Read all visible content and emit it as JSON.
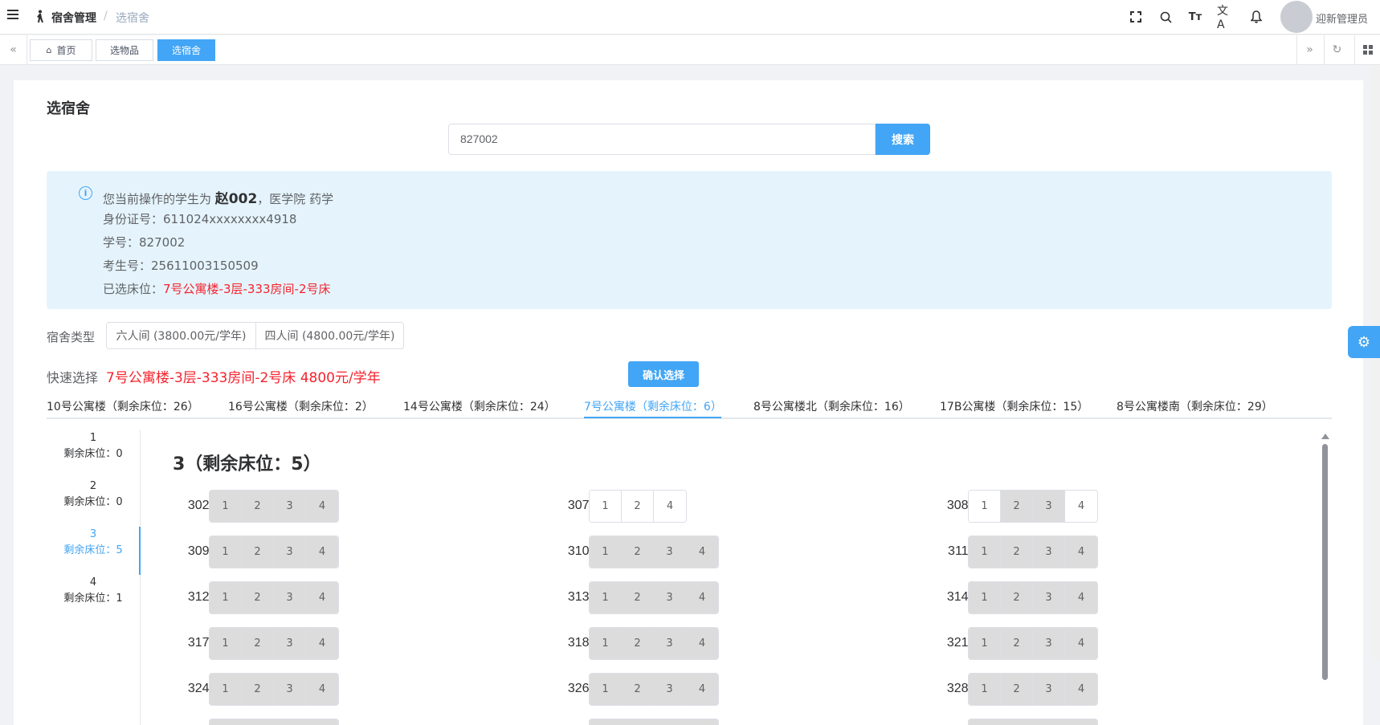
{
  "header": {
    "breadcrumb_root": "宿舍管理",
    "breadcrumb_sep": "/",
    "breadcrumb_current": "选宿舍",
    "user_name": "迎新管理员",
    "icons": [
      "fullscreen-icon",
      "search-icon",
      "font-size-icon",
      "translate-icon",
      "bell-icon"
    ]
  },
  "tags": [
    {
      "label": "首页",
      "icon": "home-icon"
    },
    {
      "label": "选物品"
    },
    {
      "label": "选宿舍",
      "active": true
    }
  ],
  "page": {
    "title": "选宿舍",
    "search_value": "827002",
    "search_button": "搜索"
  },
  "student": {
    "line1_prefix": "您当前操作的学生为",
    "name": "赵002",
    "line1_suffix": "，医学院 药学",
    "id_label": "身份证号：",
    "id_value": "611024xxxxxxxx4918",
    "sno_label": "学号：",
    "sno_value": "827002",
    "exam_label": "考生号：",
    "exam_value": "25611003150509",
    "selected_label": "已选床位：",
    "selected_value": "7号公寓楼-3层-333房间-2号床"
  },
  "room_types": {
    "label": "宿舍类型",
    "options": [
      "六人间 (3800.00元/学年)",
      "四人间 (4800.00元/学年)"
    ]
  },
  "quick": {
    "label": "快速选择",
    "value": "7号公寓楼-3层-333房间-2号床 4800元/学年",
    "confirm_button": "确认选择"
  },
  "buildings": [
    {
      "label": "10号公寓楼（剩余床位：26）"
    },
    {
      "label": "16号公寓楼（剩余床位：2）"
    },
    {
      "label": "14号公寓楼（剩余床位：24）"
    },
    {
      "label": "7号公寓楼（剩余床位：6）",
      "active": true
    },
    {
      "label": "8号公寓楼北（剩余床位：16）"
    },
    {
      "label": "17B公寓楼（剩余床位：15）"
    },
    {
      "label": "8号公寓楼南（剩余床位：29）"
    }
  ],
  "floors": [
    {
      "num": "1",
      "remain": "剩余床位：0"
    },
    {
      "num": "2",
      "remain": "剩余床位：0"
    },
    {
      "num": "3",
      "remain": "剩余床位：5",
      "active": true
    },
    {
      "num": "4",
      "remain": "剩余床位：1"
    }
  ],
  "floor_heading": "3（剩余床位：5）",
  "rooms": [
    {
      "label": "302:",
      "beds": [
        {
          "n": "1",
          "taken": true
        },
        {
          "n": "2",
          "taken": true
        },
        {
          "n": "3",
          "taken": true
        },
        {
          "n": "4",
          "taken": true
        }
      ]
    },
    {
      "label": "307:",
      "beds": [
        {
          "n": "1",
          "taken": false
        },
        {
          "n": "2",
          "taken": false
        },
        {
          "n": "4",
          "taken": false
        }
      ]
    },
    {
      "label": "308:",
      "beds": [
        {
          "n": "1",
          "taken": false
        },
        {
          "n": "2",
          "taken": true
        },
        {
          "n": "3",
          "taken": true
        },
        {
          "n": "4",
          "taken": false
        }
      ]
    },
    {
      "label": "309:",
      "beds": [
        {
          "n": "1",
          "taken": true
        },
        {
          "n": "2",
          "taken": true
        },
        {
          "n": "3",
          "taken": true
        },
        {
          "n": "4",
          "taken": true
        }
      ]
    },
    {
      "label": "310:",
      "beds": [
        {
          "n": "1",
          "taken": true
        },
        {
          "n": "2",
          "taken": true
        },
        {
          "n": "3",
          "taken": true
        },
        {
          "n": "4",
          "taken": true
        }
      ]
    },
    {
      "label": "311:",
      "beds": [
        {
          "n": "1",
          "taken": true
        },
        {
          "n": "2",
          "taken": true
        },
        {
          "n": "3",
          "taken": true
        },
        {
          "n": "4",
          "taken": true
        }
      ]
    },
    {
      "label": "312:",
      "beds": [
        {
          "n": "1",
          "taken": true
        },
        {
          "n": "2",
          "taken": true
        },
        {
          "n": "3",
          "taken": true
        },
        {
          "n": "4",
          "taken": true
        }
      ]
    },
    {
      "label": "313:",
      "beds": [
        {
          "n": "1",
          "taken": true
        },
        {
          "n": "2",
          "taken": true
        },
        {
          "n": "3",
          "taken": true
        },
        {
          "n": "4",
          "taken": true
        }
      ]
    },
    {
      "label": "314:",
      "beds": [
        {
          "n": "1",
          "taken": true
        },
        {
          "n": "2",
          "taken": true
        },
        {
          "n": "3",
          "taken": true
        },
        {
          "n": "4",
          "taken": true
        }
      ]
    },
    {
      "label": "317:",
      "beds": [
        {
          "n": "1",
          "taken": true
        },
        {
          "n": "2",
          "taken": true
        },
        {
          "n": "3",
          "taken": true
        },
        {
          "n": "4",
          "taken": true
        }
      ]
    },
    {
      "label": "318:",
      "beds": [
        {
          "n": "1",
          "taken": true
        },
        {
          "n": "2",
          "taken": true
        },
        {
          "n": "3",
          "taken": true
        },
        {
          "n": "4",
          "taken": true
        }
      ]
    },
    {
      "label": "321:",
      "beds": [
        {
          "n": "1",
          "taken": true
        },
        {
          "n": "2",
          "taken": true
        },
        {
          "n": "3",
          "taken": true
        },
        {
          "n": "4",
          "taken": true
        }
      ]
    },
    {
      "label": "324:",
      "beds": [
        {
          "n": "1",
          "taken": true
        },
        {
          "n": "2",
          "taken": true
        },
        {
          "n": "3",
          "taken": true
        },
        {
          "n": "4",
          "taken": true
        }
      ]
    },
    {
      "label": "326:",
      "beds": [
        {
          "n": "1",
          "taken": true
        },
        {
          "n": "2",
          "taken": true
        },
        {
          "n": "3",
          "taken": true
        },
        {
          "n": "4",
          "taken": true
        }
      ]
    },
    {
      "label": "328:",
      "beds": [
        {
          "n": "1",
          "taken": true
        },
        {
          "n": "2",
          "taken": true
        },
        {
          "n": "3",
          "taken": true
        },
        {
          "n": "4",
          "taken": true
        }
      ]
    }
  ],
  "colors": {
    "accent": "#42a5f5",
    "highlight": "#f5222d",
    "info_bg": "#e5f4fc",
    "bed_taken": "#dcdcdc"
  }
}
